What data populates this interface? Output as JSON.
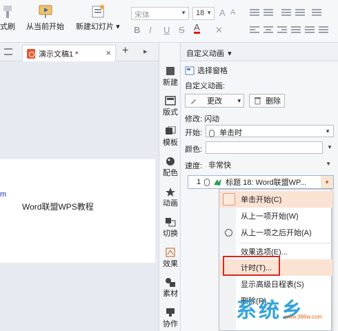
{
  "ribbon": {
    "left_label_fragment": "式刷",
    "from_current_label": "从当前开始",
    "new_slide_label": "新建幻灯片",
    "new_slide_arrow": "▾",
    "font_name": "宋体",
    "font_size": "18",
    "bold": "B",
    "italic": "I",
    "underline": "U",
    "strike": "S",
    "color_a": "A",
    "grow_a": "A",
    "shrink_a": "A",
    "clear_fmt": "✕"
  },
  "tabs": {
    "doc_title": "演示文稿1 *",
    "close": "×",
    "add": "+",
    "more": "▸"
  },
  "slide": {
    "edge_fragment": "m",
    "text": "Word联盟WPS教程"
  },
  "vbar": {
    "items": [
      "新建",
      "版式",
      "模板",
      "配色",
      "动画",
      "切换",
      "效果",
      "素材",
      "协作"
    ]
  },
  "panel": {
    "title": "自定义动画",
    "title_arrow": "▾",
    "select_pane": "选择窗格",
    "custom_anim_label": "自定义动画:",
    "change_btn": "更改",
    "change_arrow": "▾",
    "delete_btn": "删除",
    "modify_label": "修改: 闪动",
    "start_label": "开始:",
    "start_value": "单击时",
    "color_label": "颜色:",
    "speed_label": "速度:",
    "speed_value": "非常快",
    "anim_index": "1",
    "anim_title": "标题 18: Word联盟WP...",
    "anim_arrow": "▾"
  },
  "context_menu": {
    "items": [
      "单击开始(C)",
      "从上一项开始(W)",
      "从上一项之后开始(A)",
      "效果选项(E)...",
      "计时(T)...",
      "显示高级日程表(S)",
      "删除(R)"
    ]
  },
  "watermark": {
    "logo": "系统乡",
    "url": "www.386w.com"
  },
  "colors": {
    "accent_orange": "#e06a1c",
    "highlight": "#fbe3d4",
    "timing_outline": "#d8261d"
  }
}
